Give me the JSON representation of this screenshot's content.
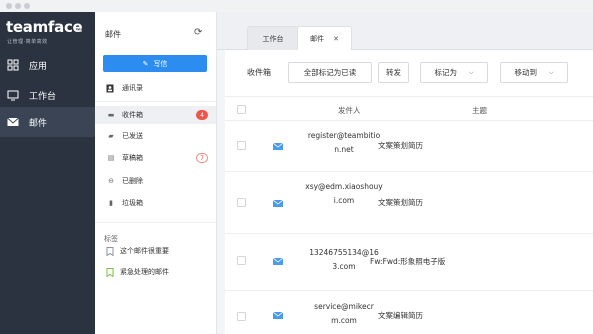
{
  "brand": {
    "name": "teamface",
    "tagline": "让管理·简单高效"
  },
  "nav": [
    {
      "label": "应用",
      "icon": "apps-icon"
    },
    {
      "label": "工作台",
      "icon": "monitor-icon"
    },
    {
      "label": "邮件",
      "icon": "mail-icon",
      "active": true
    }
  ],
  "folders": {
    "title": "邮件",
    "compose_label": "写信",
    "contacts_label": "通讯录",
    "items": [
      {
        "label": "收件箱",
        "icon": "inbox-icon",
        "badge": "4"
      },
      {
        "label": "已发送",
        "icon": "sent-icon",
        "badge": ""
      },
      {
        "label": "草稿箱",
        "icon": "draft-icon",
        "badge": "7"
      },
      {
        "label": "已删除",
        "icon": "deleted-icon",
        "badge": ""
      },
      {
        "label": "垃圾箱",
        "icon": "trash-icon",
        "badge": ""
      }
    ],
    "labels_title": "标签",
    "labels": [
      {
        "label": "这个邮件很重要",
        "color": "#8c949e"
      },
      {
        "label": "紧急处理的邮件",
        "color": "#7ac143"
      }
    ]
  },
  "tabs": [
    {
      "label": "工作台"
    },
    {
      "label": "邮件",
      "closable": true
    }
  ],
  "toolbar": {
    "current": "收件箱",
    "mark_all_read": "全部标记为已读",
    "forward": "转发",
    "mark_as": "标记为",
    "move_to": "移动到"
  },
  "table": {
    "headers": {
      "sender": "发件人",
      "subject": "主题"
    },
    "rows": [
      {
        "sender": "register@teambition.net",
        "subject": "文案策划简历"
      },
      {
        "sender": "xsy@edm.xiaoshouyi.com",
        "subject": "文案策划简历"
      },
      {
        "sender": "13246755134@163.com",
        "subject": "Fw:Fwd:形象照电子版"
      },
      {
        "sender": "service@mikecrm.com",
        "subject": "文案编辑简历"
      }
    ]
  },
  "colors": {
    "accent": "#2d8cf0",
    "nav_bg": "#2b3340",
    "badge": "#f0554b"
  }
}
